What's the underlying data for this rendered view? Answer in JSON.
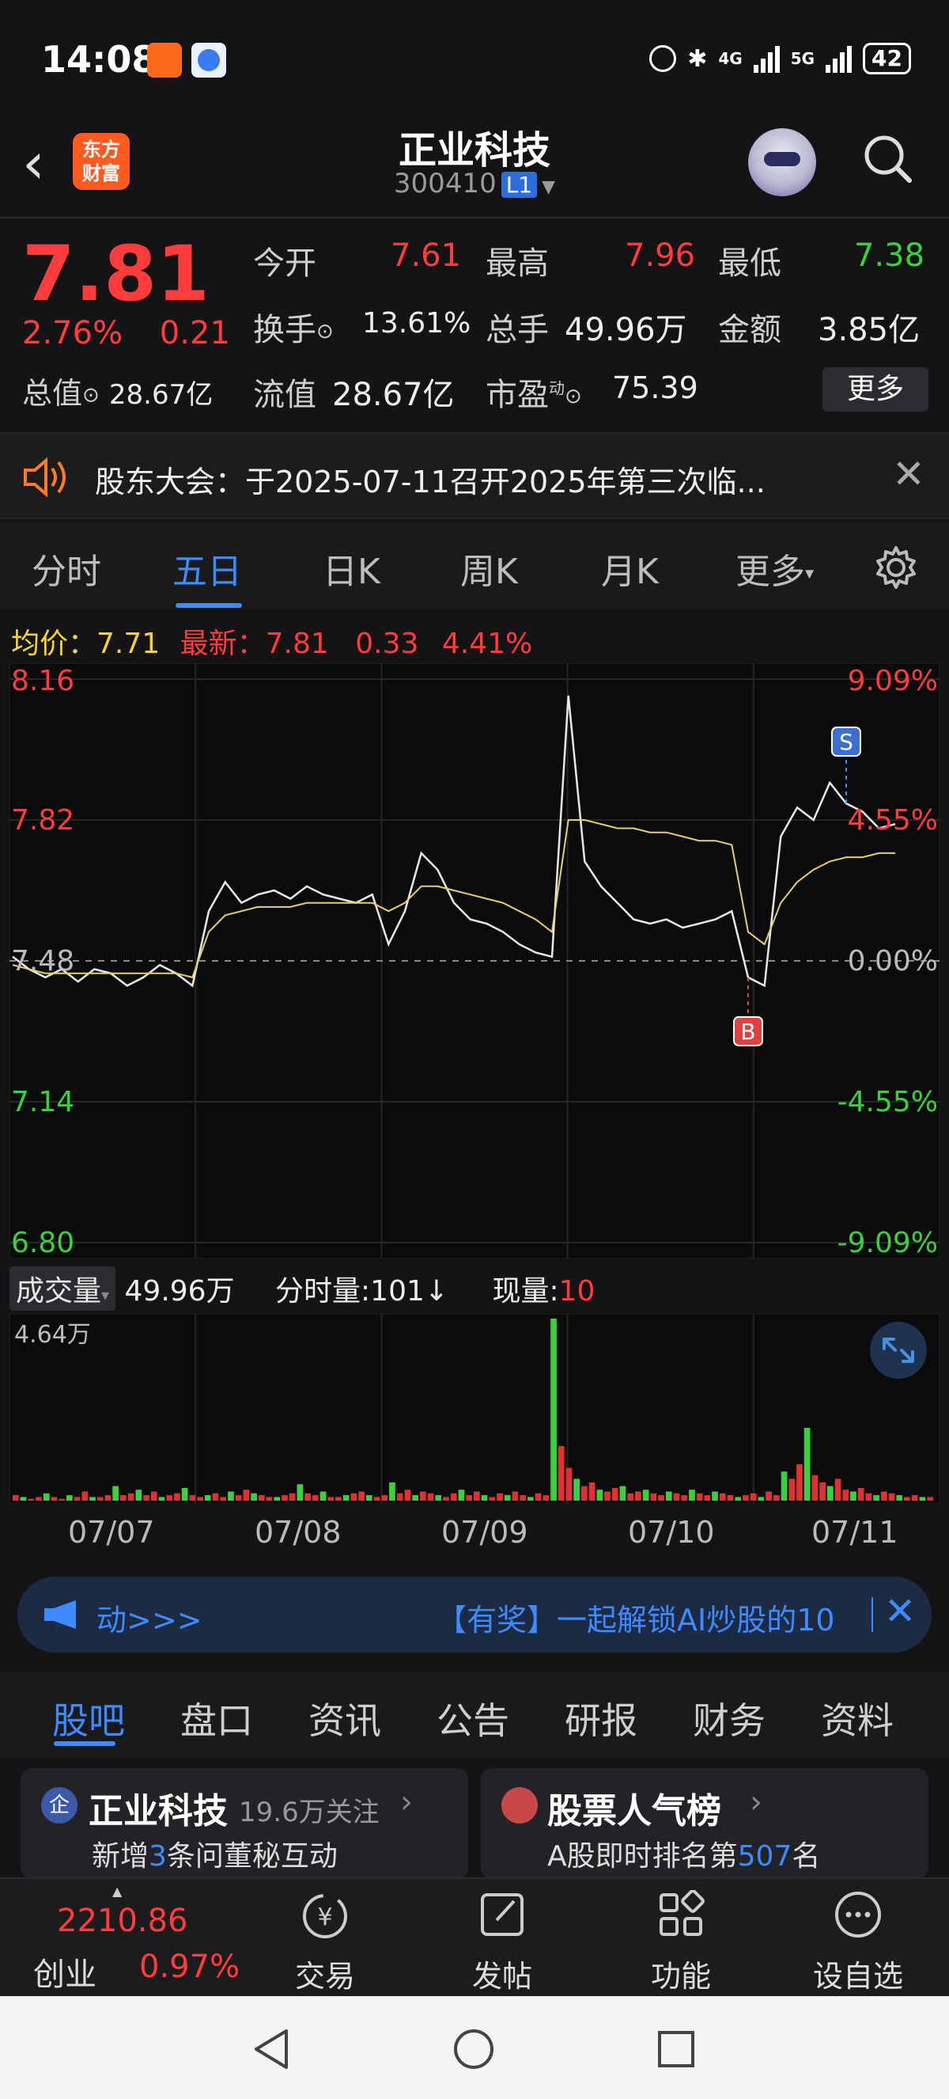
{
  "status": {
    "time": "14:08",
    "battery": "42",
    "network1": "4G",
    "network2": "5G"
  },
  "header": {
    "back_icon": "chevron-left-icon",
    "logo_line1": "东方",
    "logo_line2": "财富",
    "title": "正业科技",
    "code": "300410",
    "level_badge": "L1"
  },
  "quote": {
    "price": "7.81",
    "change_pct": "2.76%",
    "change_abs": "0.21",
    "open_label": "今开",
    "open": "7.61",
    "high_label": "最高",
    "high": "7.96",
    "low_label": "最低",
    "low": "7.38",
    "turnover_label": "换手",
    "turnover": "13.61%",
    "volume_label": "总手",
    "volume": "49.96万",
    "amount_label": "金额",
    "amount": "3.85亿",
    "mktcap_label": "总值",
    "mktcap": "28.67亿",
    "float_label": "流值",
    "float_cap": "28.67亿",
    "pe_label": "市盈",
    "pe_sup": "动",
    "pe": "75.39",
    "more": "更多"
  },
  "notice": {
    "text": "股东大会：于2025-07-11召开2025年第三次临..."
  },
  "tabs": [
    "分时",
    "五日",
    "日K",
    "周K",
    "月K",
    "更多"
  ],
  "avg_bar": {
    "avg_label": "均价：",
    "avg": "7.71",
    "latest_label": "最新：",
    "latest": "7.81",
    "chg": "0.33",
    "pct": "4.41%"
  },
  "chart_data": {
    "type": "line",
    "title": "",
    "x_dates": [
      "07/07",
      "07/08",
      "07/09",
      "07/10",
      "07/11"
    ],
    "y_ticks_left": [
      "8.16",
      "7.82",
      "7.48",
      "7.14",
      "6.80"
    ],
    "y_ticks_right": [
      "9.09%",
      "4.55%",
      "0.00%",
      "-4.55%",
      "-9.09%"
    ],
    "ylim": [
      6.8,
      8.16
    ],
    "prev_close": 7.48,
    "series": [
      {
        "name": "price",
        "values": [
          7.49,
          7.46,
          7.44,
          7.46,
          7.43,
          7.46,
          7.45,
          7.42,
          7.44,
          7.47,
          7.45,
          7.42,
          7.6,
          7.67,
          7.62,
          7.64,
          7.65,
          7.63,
          7.66,
          7.64,
          7.63,
          7.62,
          7.64,
          7.52,
          7.6,
          7.74,
          7.7,
          7.62,
          7.58,
          7.57,
          7.55,
          7.52,
          7.5,
          7.49,
          8.12,
          7.72,
          7.66,
          7.62,
          7.58,
          7.57,
          7.58,
          7.56,
          7.57,
          7.58,
          7.6,
          7.44,
          7.42,
          7.78,
          7.85,
          7.82,
          7.91,
          7.86,
          7.84,
          7.8,
          7.81
        ]
      },
      {
        "name": "avg",
        "values": [
          7.47,
          7.46,
          7.45,
          7.45,
          7.45,
          7.45,
          7.45,
          7.45,
          7.45,
          7.45,
          7.45,
          7.44,
          7.55,
          7.59,
          7.6,
          7.61,
          7.61,
          7.61,
          7.62,
          7.62,
          7.62,
          7.62,
          7.62,
          7.6,
          7.62,
          7.66,
          7.66,
          7.65,
          7.64,
          7.63,
          7.62,
          7.6,
          7.58,
          7.55,
          7.82,
          7.82,
          7.81,
          7.8,
          7.8,
          7.79,
          7.79,
          7.78,
          7.77,
          7.77,
          7.76,
          7.55,
          7.52,
          7.62,
          7.67,
          7.7,
          7.72,
          7.73,
          7.73,
          7.74,
          7.74
        ]
      }
    ],
    "markers": [
      {
        "label": "B",
        "index": 45
      },
      {
        "label": "S",
        "index": 51
      }
    ]
  },
  "volume": {
    "dropdown": "成交量",
    "total": "49.96万",
    "tick_label_text": "分时量:",
    "tick_value": "101",
    "current_label": "现量:",
    "current_value": "10",
    "max_label": "4.64万",
    "bars": [
      3,
      2,
      1,
      2,
      4,
      2,
      1,
      3,
      2,
      5,
      2,
      2,
      3,
      8,
      3,
      4,
      6,
      3,
      5,
      2,
      3,
      4,
      7,
      3,
      2,
      3,
      4,
      2,
      5,
      3,
      6,
      4,
      3,
      2,
      2,
      3,
      4,
      9,
      4,
      3,
      5,
      2,
      2,
      3,
      4,
      5,
      3,
      2,
      3,
      10,
      4,
      6,
      3,
      5,
      4,
      3,
      2,
      4,
      6,
      3,
      5,
      3,
      2,
      4,
      3,
      5,
      3,
      2,
      4,
      3,
      100,
      30,
      18,
      12,
      8,
      10,
      6,
      5,
      7,
      8,
      4,
      5,
      6,
      4,
      3,
      5,
      4,
      3,
      6,
      4,
      3,
      5,
      4,
      3,
      2,
      3,
      4,
      2,
      5,
      3,
      16,
      12,
      20,
      40,
      14,
      10,
      8,
      12,
      6,
      5,
      7,
      4,
      3,
      5,
      4,
      3,
      2,
      3,
      2,
      2
    ]
  },
  "promo": {
    "left": "动>>>",
    "right": "【有奖】一起解锁AI炒股的10"
  },
  "subtabs": [
    "股吧",
    "盘口",
    "资讯",
    "公告",
    "研报",
    "财务",
    "资料"
  ],
  "card_left": {
    "badge": "企",
    "name": "正业科技",
    "follow": "19.6万关注",
    "line2_a": "新增",
    "line2_num": "3",
    "line2_b": "条问董秘互动"
  },
  "card_right": {
    "title": "股票人气榜",
    "line2_a": "A股即时排名第",
    "line2_num": "507",
    "line2_b": "名"
  },
  "bottomnav": {
    "index_value": "2210.86",
    "index_name": "创业",
    "index_pct": "0.97%",
    "items": [
      "交易",
      "发帖",
      "功能",
      "设自选"
    ]
  },
  "colors": {
    "up": "#ff3b3b",
    "down": "#3bd13b",
    "accent": "#3d8bff",
    "avg": "#f5d23a"
  }
}
